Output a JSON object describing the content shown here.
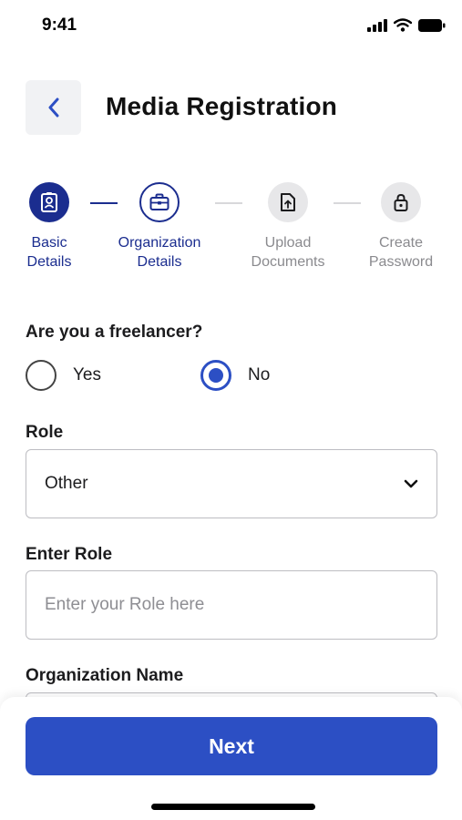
{
  "status_bar": {
    "time": "9:41"
  },
  "header": {
    "title": "Media Registration"
  },
  "stepper": {
    "steps": [
      {
        "line1": "Basic",
        "line2": "Details",
        "state": "done",
        "icon": "id-badge-icon"
      },
      {
        "line1": "Organization",
        "line2": "Details",
        "state": "active",
        "icon": "briefcase-icon"
      },
      {
        "line1": "Upload",
        "line2": "Documents",
        "state": "todo",
        "icon": "upload-file-icon"
      },
      {
        "line1": "Create",
        "line2": "Password",
        "state": "todo",
        "icon": "lock-icon"
      }
    ]
  },
  "form": {
    "freelancer_question": "Are you a freelancer?",
    "option_yes": "Yes",
    "option_no": "No",
    "selected_option": "No",
    "role_label": "Role",
    "role_value": "Other",
    "enter_role_label": "Enter Role",
    "enter_role_placeholder": "Enter your Role here",
    "enter_role_value": "",
    "org_name_label": "Organization Name"
  },
  "footer": {
    "next_label": "Next"
  },
  "colors": {
    "primary": "#2c4fc4",
    "stepper_active": "#1b2d8f",
    "stepper_inactive": "#8a8a8e",
    "stepper_inactive_bg": "#e7e7e9"
  }
}
